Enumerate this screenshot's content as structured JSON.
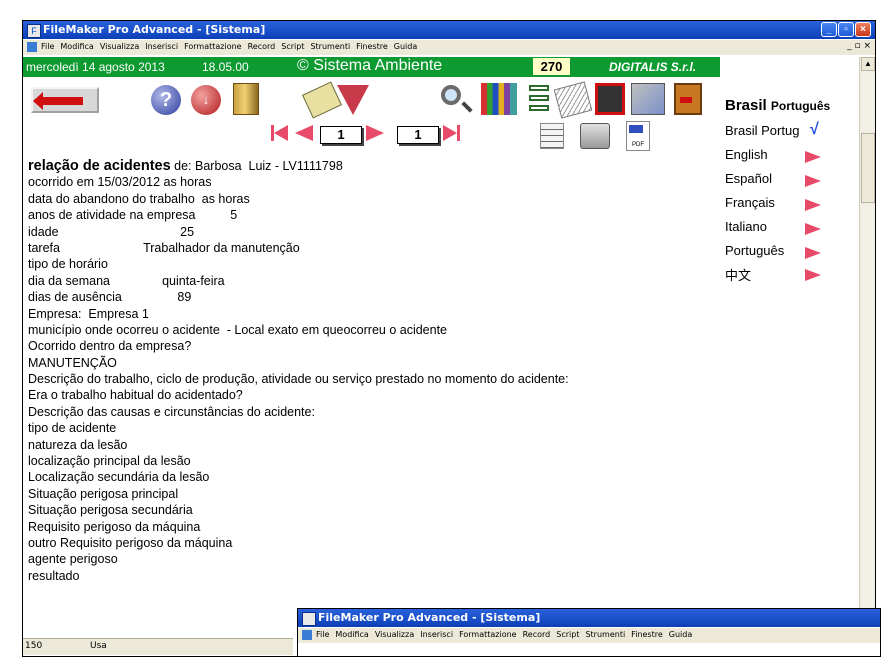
{
  "window": {
    "title": "FileMaker Pro Advanced - [Sistema]",
    "menu": [
      "File",
      "Modifica",
      "Visualizza",
      "Inserisci",
      "Formattazione",
      "Record",
      "Script",
      "Strumenti",
      "Finestre",
      "Guida"
    ],
    "mdi_controls": "_ ▫ ×"
  },
  "header": {
    "date": "mercoledì 14 agosto 2013",
    "time": "18.05.00",
    "brand": "© Sistema Ambiente",
    "record_count": "270",
    "company": "DIGITALIS S.r.l."
  },
  "toolbar": {
    "help_label": "?",
    "record_label": "↓"
  },
  "navigator": {
    "current_record": "1",
    "total_records": "1"
  },
  "report": {
    "title_bold": "relação de acidentes",
    "title_rest": " de: Barbosa  Luiz - LV1111798",
    "lines": [
      "ocorrido em 15/03/2012 as horas",
      "data do abandono do trabalho  as horas",
      "anos de atividade na empresa          5",
      "idade                                   25",
      "tarefa                        Trabalhador da manutenção",
      "tipo de horário",
      "dia da semana               quinta-feira",
      "dias de ausência                89",
      "Empresa:  Empresa 1",
      "município onde ocorreu o acidente  - Local exato em queocorreu o acidente",
      "Ocorrido dentro da empresa?",
      "MANUTENÇÃO",
      "Descrição do trabalho, ciclo de produção, atividade ou serviço prestado no momento do acidente:",
      "Era o trabalho habitual do acidentado?",
      "Descrição das causas e circunstâncias do acidente:",
      "tipo de acidente",
      "natureza da lesão",
      "localização principal da lesão",
      "Localização secundária da lesão",
      "Situação perigosa principal",
      "Situação perigosa secundária",
      "Requisito perigoso da máquina",
      "outro Requisito perigoso da máquina",
      "agente perigoso",
      "resultado"
    ]
  },
  "languages": {
    "current_main": "Brasil",
    "current_sub": "Português",
    "items": [
      {
        "label": "Brasil Portug",
        "selected": true
      },
      {
        "label": "English"
      },
      {
        "label": "Español"
      },
      {
        "label": "Français"
      },
      {
        "label": "Italiano"
      },
      {
        "label": "Português"
      },
      {
        "label": "中文"
      }
    ],
    "selected_mark": "√",
    "arrow_color": "#e84a6a"
  },
  "statusbar": {
    "zoom": "150",
    "mode": "Usa"
  },
  "second_window": {
    "title": "FileMaker Pro Advanced - [Sistema]",
    "menu": [
      "File",
      "Modifica",
      "Visualizza",
      "Inserisci",
      "Formattazione",
      "Record",
      "Script",
      "Strumenti",
      "Finestre",
      "Guida"
    ]
  },
  "colors": {
    "title_blue": "#0b3fb8",
    "header_green": "#0d9a30",
    "nav_red": "#e84a6a"
  }
}
